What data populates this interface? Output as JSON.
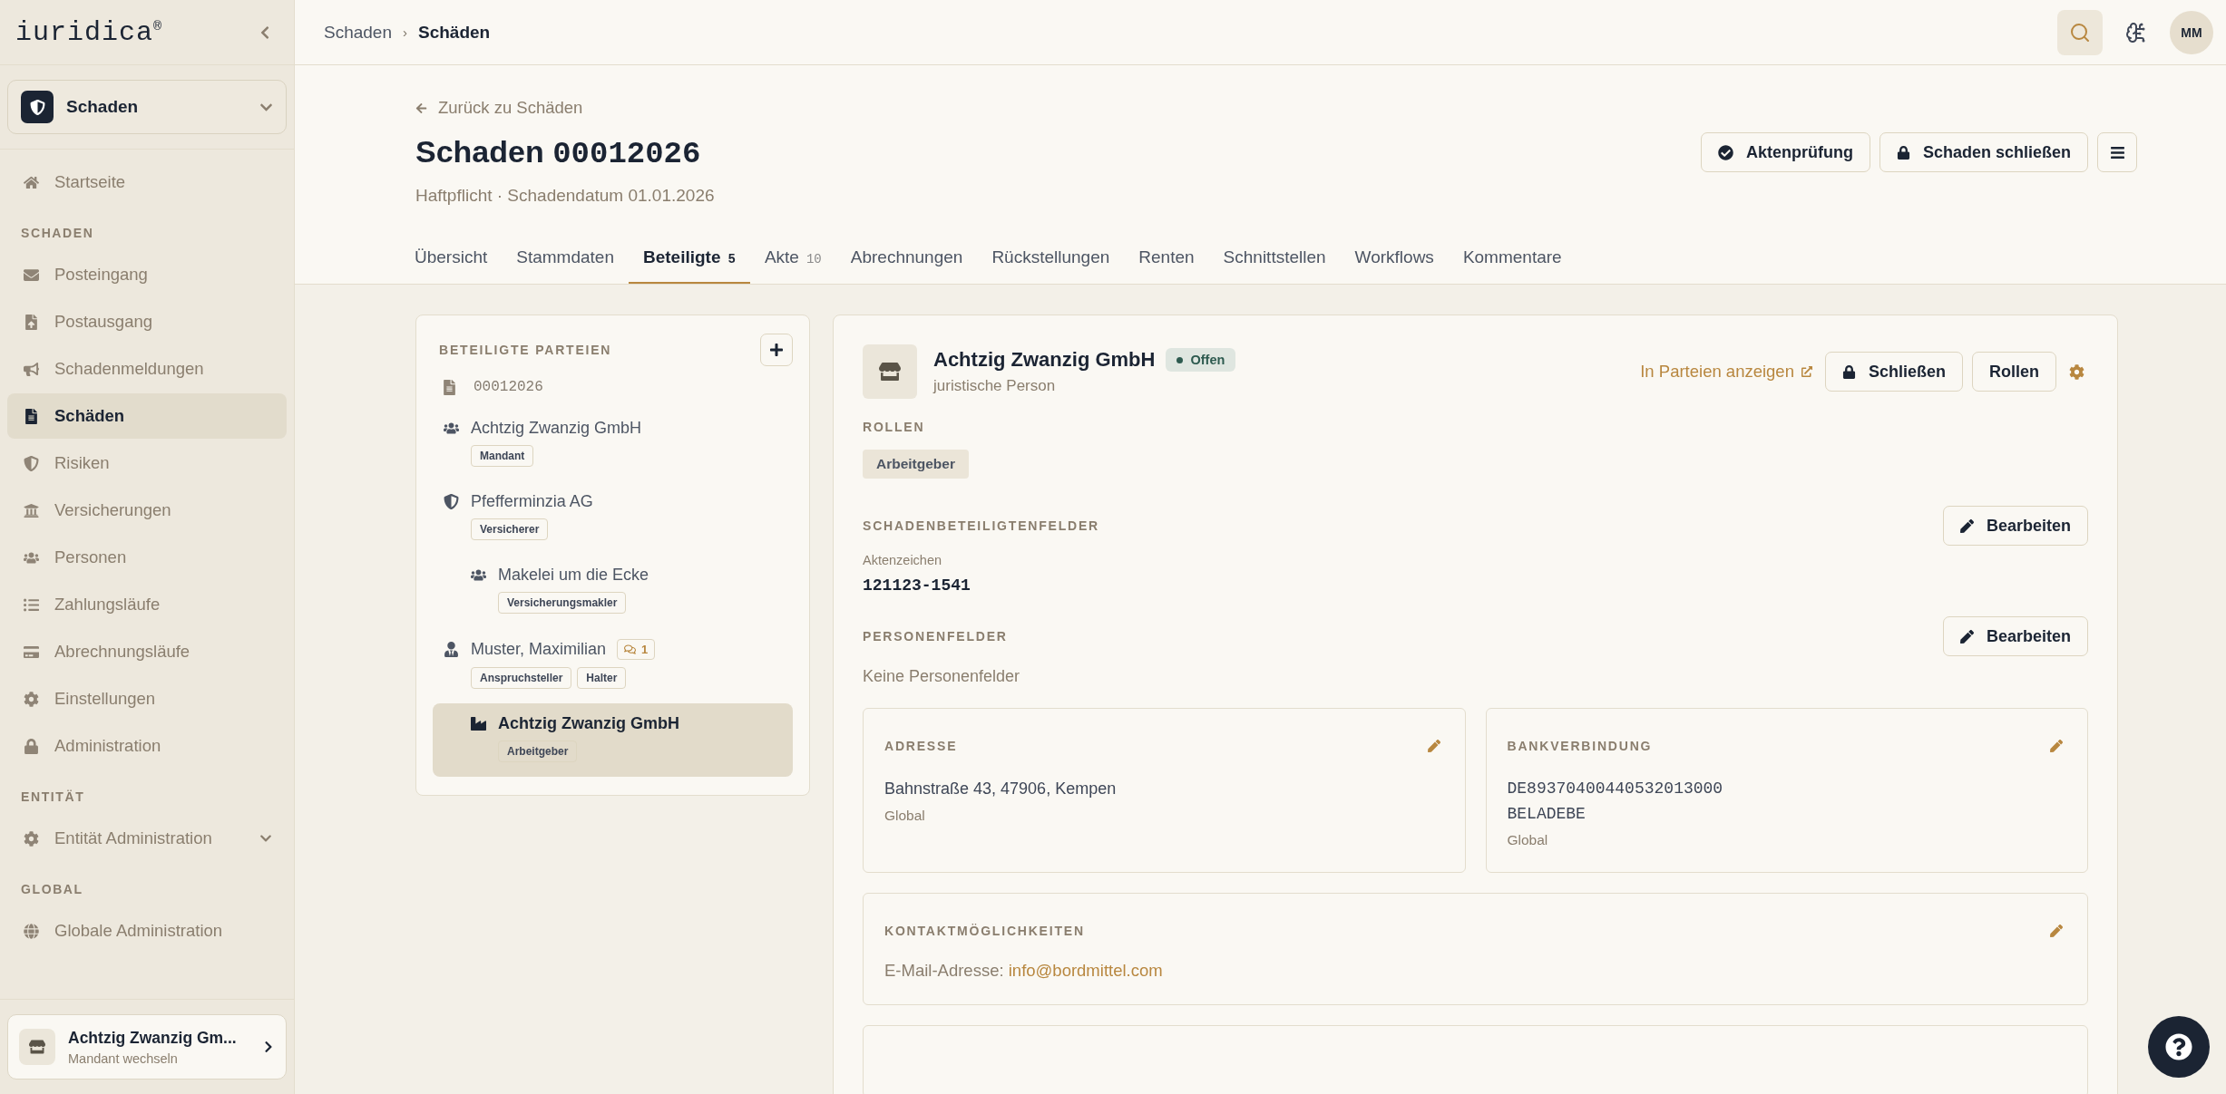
{
  "sidebar": {
    "logo": "iuridica",
    "logo_mark": "®",
    "module": {
      "label": "Schaden"
    },
    "top_items": [
      {
        "label": "Startseite",
        "selected": false
      }
    ],
    "sections": [
      {
        "heading": "SCHADEN",
        "items": [
          {
            "label": "Posteingang",
            "selected": false
          },
          {
            "label": "Postausgang",
            "selected": false
          },
          {
            "label": "Schadenmeldungen",
            "selected": false
          },
          {
            "label": "Schäden",
            "selected": true
          },
          {
            "label": "Risiken",
            "selected": false
          },
          {
            "label": "Versicherungen",
            "selected": false
          },
          {
            "label": "Personen",
            "selected": false
          },
          {
            "label": "Zahlungsläufe",
            "selected": false
          },
          {
            "label": "Abrechnungsläufe",
            "selected": false
          },
          {
            "label": "Einstellungen",
            "selected": false
          },
          {
            "label": "Administration",
            "selected": false
          }
        ]
      },
      {
        "heading": "ENTITÄT",
        "items": [
          {
            "label": "Entität Administration",
            "selected": false,
            "expanded": false
          }
        ]
      },
      {
        "heading": "GLOBAL",
        "items": [
          {
            "label": "Globale Administration",
            "selected": false
          }
        ]
      }
    ],
    "client": {
      "name": "Achtzig Zwanzig Gm...",
      "action": "Mandant wechseln"
    }
  },
  "breadcrumb": [
    "Schaden",
    "Schäden"
  ],
  "breadcrumb_separator": "›",
  "user": {
    "initials": "MM"
  },
  "back_link": "Zurück zu Schäden",
  "title": {
    "prefix": "Schaden",
    "number": "00012026"
  },
  "subtitle": "Haftpflicht · Schadendatum 01.01.2026",
  "header_buttons": [
    {
      "label": "Aktenprüfung"
    },
    {
      "label": "Schaden schließen"
    }
  ],
  "tabs": [
    {
      "label": "Übersicht",
      "selected": false
    },
    {
      "label": "Stammdaten",
      "selected": false
    },
    {
      "label": "Beteiligte",
      "count": "5",
      "selected": true
    },
    {
      "label": "Akte",
      "count": "10",
      "selected": false
    },
    {
      "label": "Abrechnungen",
      "selected": false
    },
    {
      "label": "Rückstellungen",
      "selected": false
    },
    {
      "label": "Renten",
      "selected": false
    },
    {
      "label": "Schnittstellen",
      "selected": false
    },
    {
      "label": "Workflows",
      "selected": false
    },
    {
      "label": "Kommentare",
      "selected": false
    }
  ],
  "parties": {
    "heading": "BETEILIGTE PARTEIEN",
    "root": "00012026",
    "children": [
      {
        "name": "Achtzig Zwanzig GmbH",
        "kind": "group",
        "roles": [
          "Mandant"
        ],
        "selected": false
      },
      {
        "name": "Pfefferminzia AG",
        "kind": "insurer",
        "roles": [
          "Versicherer"
        ],
        "selected": false,
        "children": [
          {
            "name": "Makelei um die Ecke",
            "kind": "group",
            "roles": [
              "Versicherungsmakler"
            ],
            "selected": false
          }
        ]
      },
      {
        "name": "Muster, Maximilian",
        "kind": "person",
        "comments": "1",
        "roles": [
          "Anspruchsteller",
          "Halter"
        ],
        "selected": false,
        "children": [
          {
            "name": "Achtzig Zwanzig GmbH",
            "kind": "company",
            "roles": [
              "Arbeitgeber"
            ],
            "selected": true
          }
        ]
      }
    ]
  },
  "detail": {
    "name": "Achtzig Zwanzig GmbH",
    "status": "Offen",
    "type": "juristische Person",
    "actions": {
      "link": "In Parteien anzeigen",
      "buttons": [
        "Schließen",
        "Rollen"
      ]
    },
    "roles_heading": "ROLLEN",
    "roles": [
      "Arbeitgeber"
    ],
    "claim_fields": {
      "heading": "SCHADENBETEILIGTENFELDER",
      "button": "Bearbeiten",
      "fields": [
        {
          "label": "Aktenzeichen",
          "value": "121123-1541"
        }
      ]
    },
    "person_fields": {
      "heading": "PERSONENFELDER",
      "button": "Bearbeiten",
      "empty": "Keine Personenfelder"
    },
    "address": {
      "heading": "ADRESSE",
      "lines": [
        "Bahnstraße 43, 47906, Kempen"
      ],
      "scope": "Global"
    },
    "bank": {
      "heading": "BANKVERBINDUNG",
      "lines": [
        "DE89370400440532013000",
        "BELADEBE"
      ],
      "scope": "Global"
    },
    "contact": {
      "heading": "KONTAKTMÖGLICHKEITEN",
      "label": "E-Mail-Adresse:",
      "email": "info@bordmittel.com"
    }
  }
}
